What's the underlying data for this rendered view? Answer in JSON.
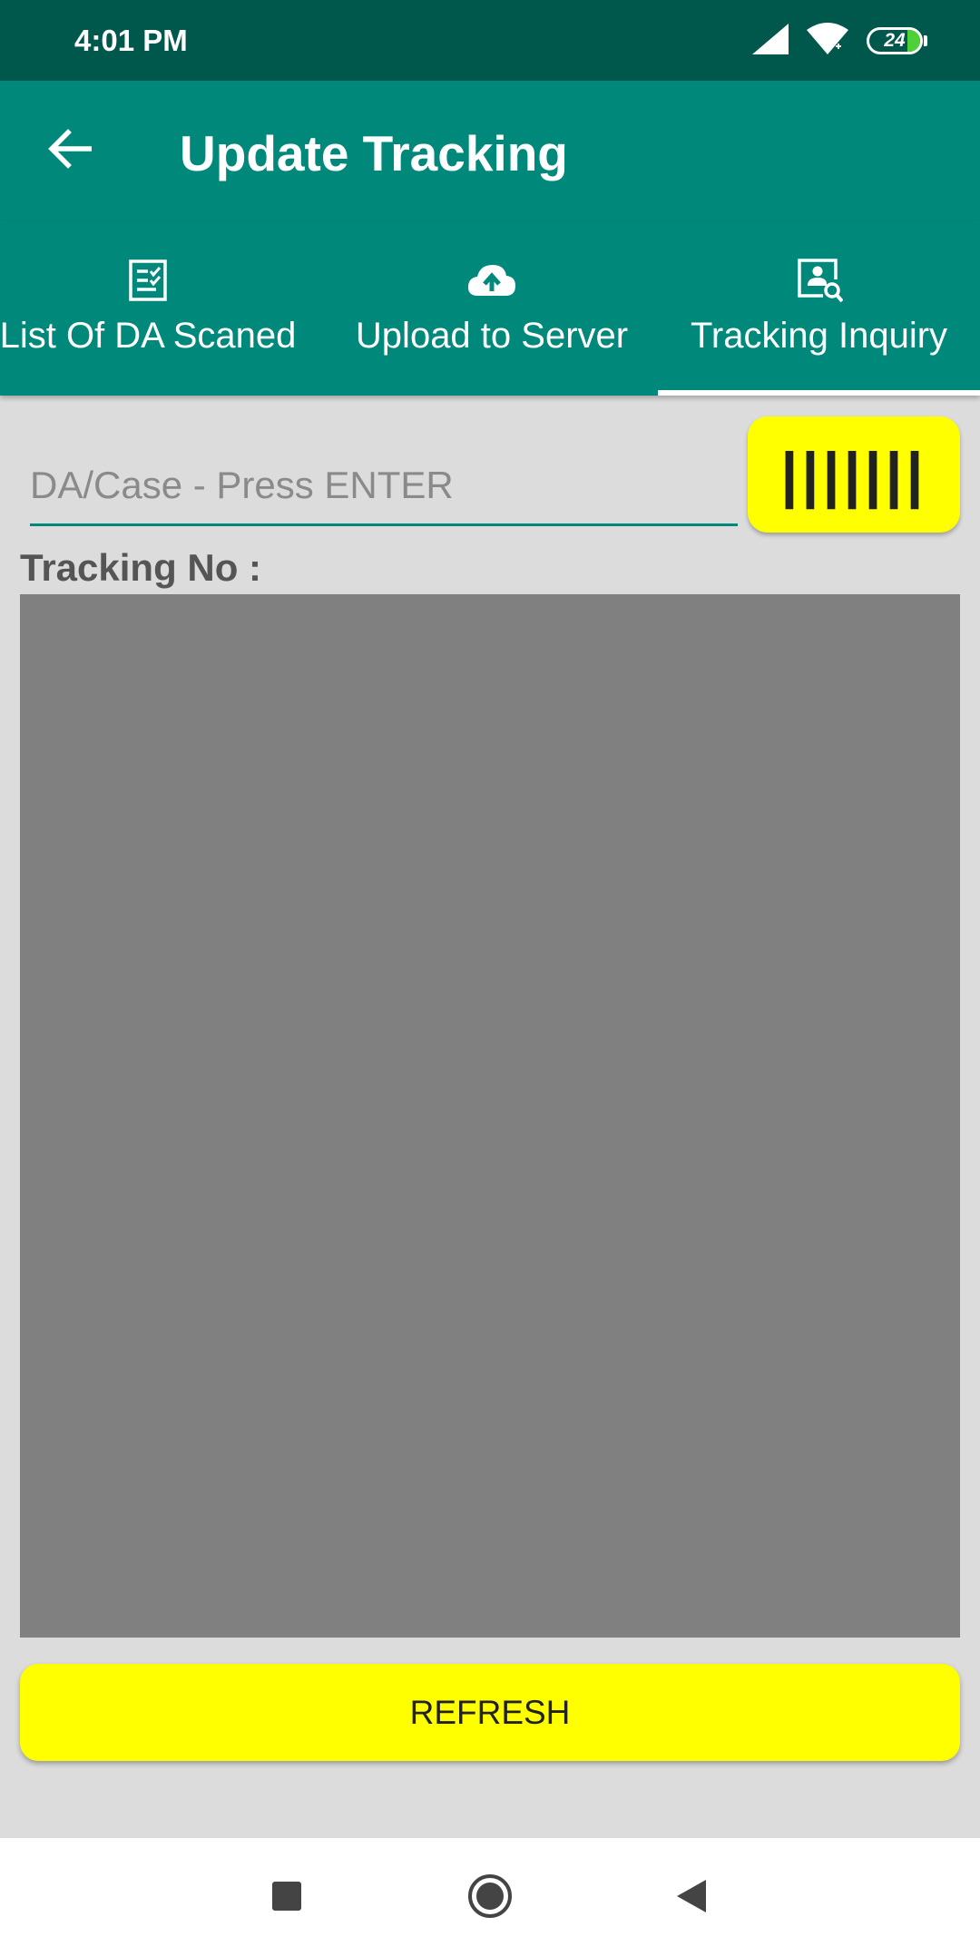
{
  "status_bar": {
    "time": "4:01 PM",
    "battery_level": "24",
    "icons": [
      "signal-icon",
      "wifi-icon",
      "battery-icon"
    ]
  },
  "app_bar": {
    "title": "Update Tracking",
    "back_icon": "arrow-back-icon"
  },
  "tabs": [
    {
      "label": "List Of DA Scaned",
      "icon": "checklist-icon",
      "selected": false
    },
    {
      "label": "Upload to Server",
      "icon": "cloud-upload-icon",
      "selected": false
    },
    {
      "label": "Tracking Inquiry",
      "icon": "contact-search-icon",
      "selected": true
    }
  ],
  "search": {
    "value": "",
    "placeholder": "DA/Case - Press ENTER"
  },
  "scan_button": {
    "label": "|||||||"
  },
  "tracking": {
    "label": "Tracking No :"
  },
  "refresh_button": {
    "label": "REFRESH"
  },
  "nav_bar": {
    "buttons": [
      "recents-icon",
      "home-icon",
      "back-icon"
    ]
  },
  "colors": {
    "status_bar": "#00574b",
    "primary": "#00897b",
    "accent_yellow": "#ffff00",
    "background": "#dcdcdc",
    "panel_gray": "#808080"
  }
}
